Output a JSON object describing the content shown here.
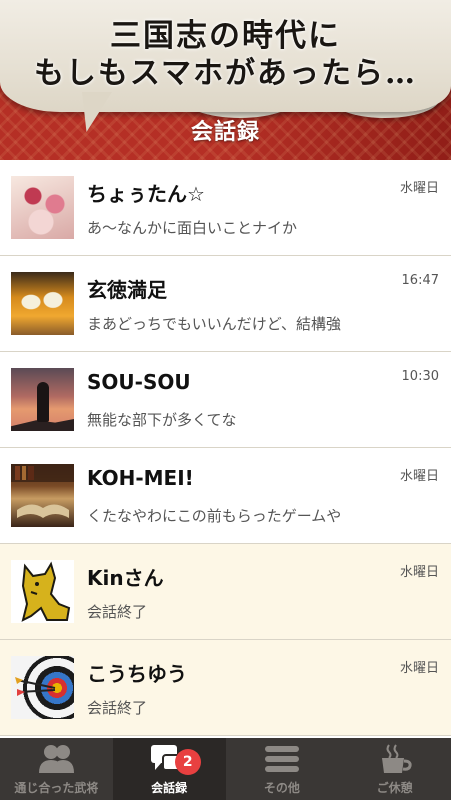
{
  "header": {
    "banner_line1": "三国志の時代に",
    "banner_line2": "もしもスマホがあったら…",
    "section_title": "会話録"
  },
  "conversations": [
    {
      "name": "ちょぅたん☆",
      "message": "あ〜なんかに面白いことナイか",
      "time": "水曜日",
      "avatar": "sweets-photo",
      "ended": false
    },
    {
      "name": "玄徳満足",
      "message": "まあどっちでもいいんだけど、結構強",
      "time": "16:47",
      "avatar": "beer-toast-photo",
      "ended": false
    },
    {
      "name": "SOU-SOU",
      "message": "無能な部下が多くてな",
      "time": "10:30",
      "avatar": "silhouette-sunset-photo",
      "ended": false
    },
    {
      "name": "KOH-MEI!",
      "message": "くたなやわにこの前もらったゲームや",
      "time": "水曜日",
      "avatar": "old-book-photo",
      "ended": false
    },
    {
      "name": "Kinさん",
      "message": "会話終了",
      "time": "水曜日",
      "avatar": "yellow-dog-illustration",
      "ended": true
    },
    {
      "name": "こうちゆう",
      "message": "会話終了",
      "time": "水曜日",
      "avatar": "archery-target-photo",
      "ended": true
    }
  ],
  "tabbar": {
    "tabs": [
      {
        "label": "通じ合った武将",
        "icon": "people-icon",
        "active": false
      },
      {
        "label": "会話録",
        "icon": "chat-bubbles-icon",
        "active": true,
        "badge": "2"
      },
      {
        "label": "その他",
        "icon": "menu-icon",
        "active": false
      },
      {
        "label": "ご休憩",
        "icon": "tea-cup-icon",
        "active": false
      }
    ]
  },
  "colors": {
    "header_red": "#9f231b",
    "ended_row_bg": "#fdf7e6",
    "tabbar_bg": "#3a3735",
    "badge_red": "#e84040"
  }
}
